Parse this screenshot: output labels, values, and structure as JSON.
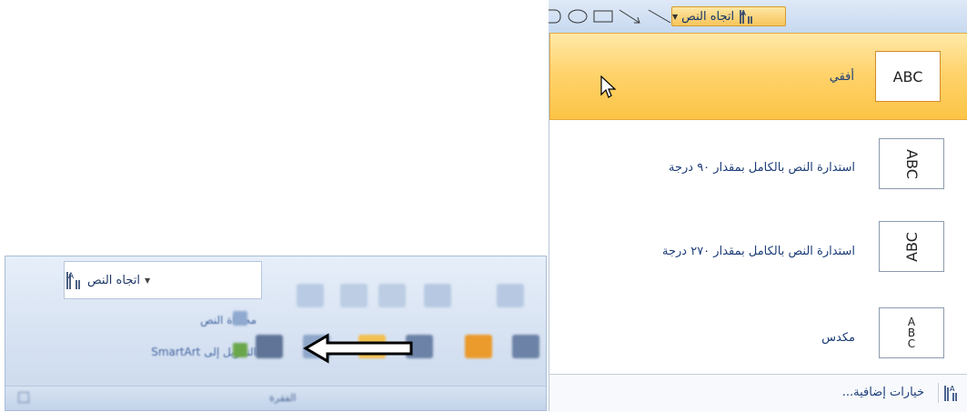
{
  "header": {
    "text_direction_label": "اتجاه النص",
    "shape_icons": [
      "rounded-rect-icon",
      "ellipse-icon",
      "rectangle-icon",
      "arrow-icon",
      "line-icon",
      "textbox-icon"
    ]
  },
  "menu": {
    "items": [
      {
        "label": "أفقي",
        "thumb_text": "ABC",
        "highlighted": true
      },
      {
        "label": "استدارة النص بالكامل بمقدار ٩٠ درجة",
        "thumb_text": "ABC"
      },
      {
        "label": "استدارة النص بالكامل بمقدار ٢٧٠ درجة",
        "thumb_text": "ABC"
      },
      {
        "label": "مكدس",
        "thumb_letters": [
          "A",
          "B",
          "C"
        ]
      }
    ],
    "footer_label": "خيارات إضافية..."
  },
  "ribbon": {
    "text_direction_label": "اتجاه النص",
    "align_text_label": "محاذاة النص",
    "smartart_label": "التحويل إلى SmartArt",
    "group_label": "الفقرة"
  },
  "colors": {
    "highlight": "#ffd36d",
    "menu_text": "#1c3d78",
    "ribbon_bg": "#dbe6f4"
  }
}
